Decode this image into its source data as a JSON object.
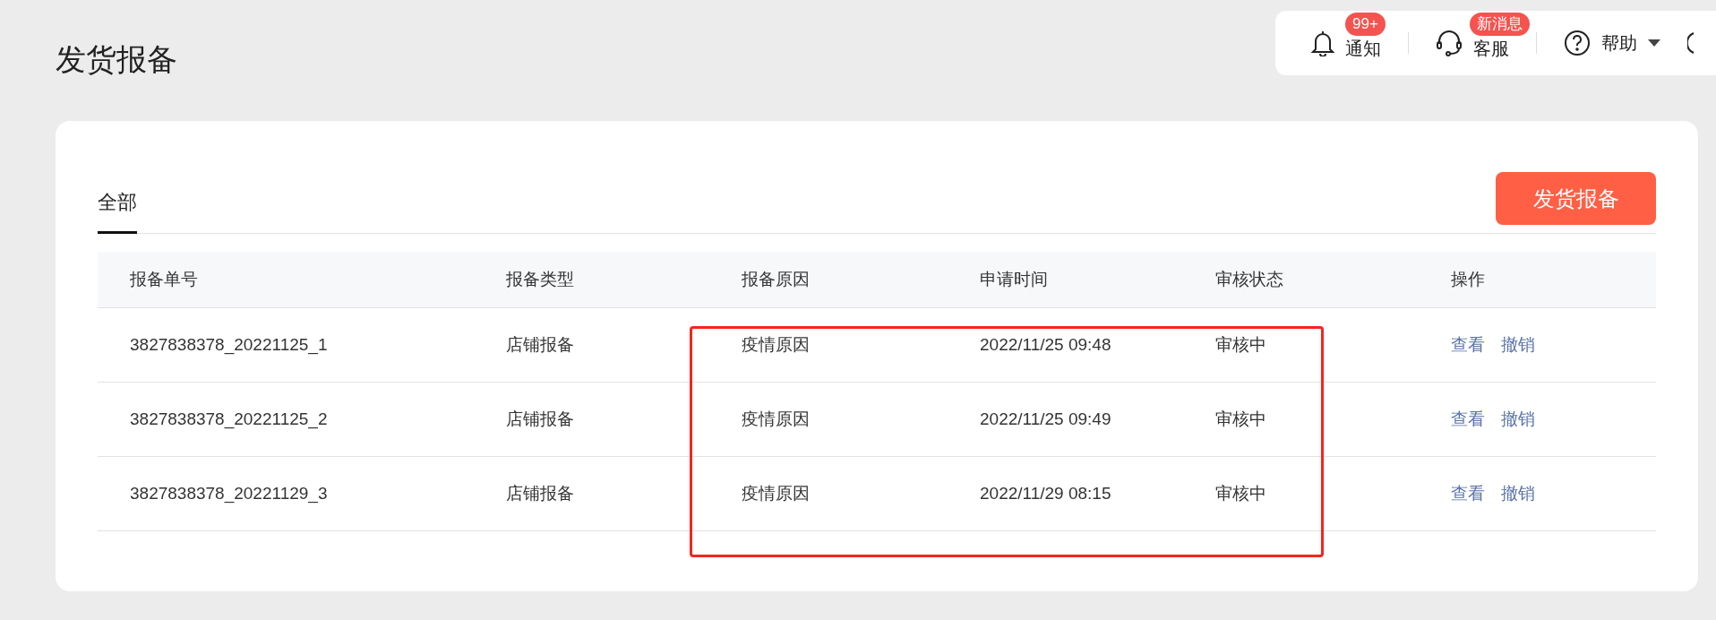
{
  "page_title": "发货报备",
  "top_bar": [
    {
      "kind": "bell",
      "label": "通知",
      "badge": "99+"
    },
    {
      "kind": "headset",
      "label": "客服",
      "badge": "新消息"
    },
    {
      "kind": "help",
      "label": "帮助"
    }
  ],
  "tabs": [
    {
      "label": "全部",
      "selected": true
    }
  ],
  "primary_button": "发货报备",
  "table": {
    "columns": [
      "报备单号",
      "报备类型",
      "报备原因",
      "申请时间",
      "审核状态",
      "操作"
    ],
    "rows": [
      {
        "cells": [
          "3827838378_20221125_1",
          "店铺报备",
          "疫情原因",
          "2022/11/25 09:48",
          "审核中"
        ],
        "actions": [
          "查看",
          "撤销"
        ]
      },
      {
        "cells": [
          "3827838378_20221125_2",
          "店铺报备",
          "疫情原因",
          "2022/11/25 09:49",
          "审核中"
        ],
        "actions": [
          "查看",
          "撤销"
        ]
      },
      {
        "cells": [
          "3827838378_20221129_3",
          "店铺报备",
          "疫情原因",
          "2022/11/29 08:15",
          "审核中"
        ],
        "actions": [
          "查看",
          "撤销"
        ]
      }
    ]
  }
}
